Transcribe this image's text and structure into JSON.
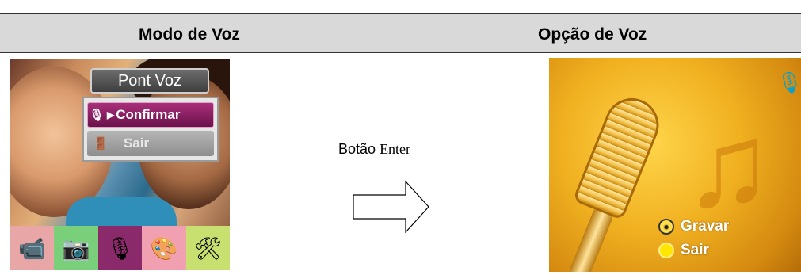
{
  "header": {
    "left_title": "Modo de Voz",
    "right_title": "Opção de Voz"
  },
  "left_screen": {
    "menu_title": "Pont Voz",
    "items": [
      {
        "label": "Confirmar",
        "icon": "microphone-icon",
        "selected": true
      },
      {
        "label": "Sair",
        "icon": "exit-door-icon",
        "selected": false
      }
    ],
    "bottom_bar": [
      {
        "icon": "camcorder-icon",
        "color": "#e8a6a6"
      },
      {
        "icon": "camera-icon",
        "color": "#7ad07a"
      },
      {
        "icon": "microphone-icon",
        "color": "#8a2a6a"
      },
      {
        "icon": "palette-icon",
        "color": "#f0a0b0"
      },
      {
        "icon": "tools-icon",
        "color": "#c8e070"
      }
    ]
  },
  "middle": {
    "label_main": "Botão",
    "label_key": "Enter"
  },
  "right_screen": {
    "status_icon": "microphone-icon",
    "options": [
      {
        "label": "Gravar",
        "icon": "record-icon"
      },
      {
        "label": "Sair",
        "icon": "exit-circle-icon"
      }
    ]
  }
}
